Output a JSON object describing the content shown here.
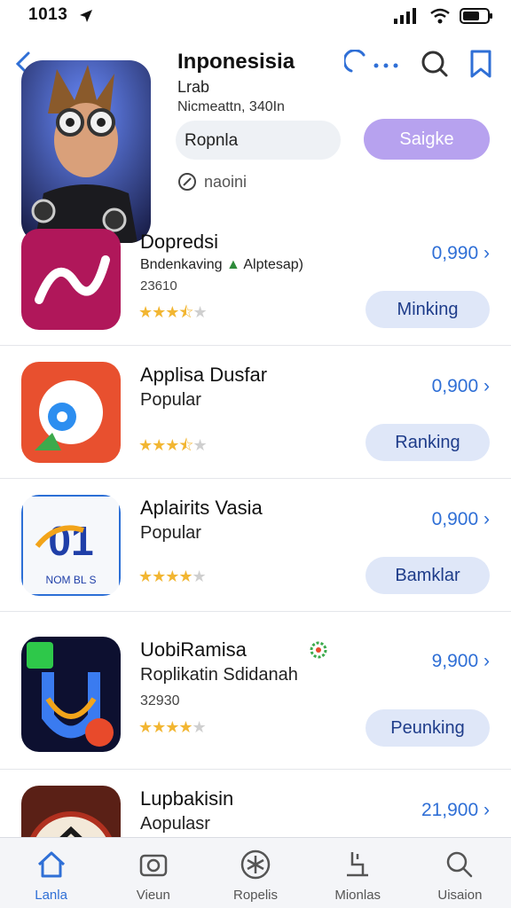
{
  "status_bar": {
    "time": "1013"
  },
  "hero": {
    "title": "Inponesisia",
    "subtitle": "Lrab",
    "line2": "Nicmeattn, 340In",
    "field_value": "Ropnla",
    "action_label": "Saigke",
    "meta_label": "naoini"
  },
  "apps": [
    {
      "title": "Dopredsi",
      "subtitle": "Bndenkaving",
      "subtitle_extra": "Alptesap)",
      "extra": "23610",
      "price": "0,990",
      "button": "Minking",
      "rating": 3.5
    },
    {
      "title": "Applisa Dusfar",
      "subtitle": "Popular",
      "extra": "",
      "price": "0,900",
      "button": "Ranking",
      "rating": 3.5
    },
    {
      "title": "Aplairits Vasia",
      "subtitle": "Popular",
      "extra": "",
      "price": "0,900",
      "button": "Bamklar",
      "rating": 4
    },
    {
      "title": "UobiRamisa",
      "subtitle": "Roplikatin Sdidanah",
      "extra": "32930",
      "price": "9,900",
      "button": "Peunking",
      "rating": 4.5
    },
    {
      "title": "Lupbakisin",
      "subtitle": "Aopulasr",
      "extra": "",
      "price": "21,900",
      "button": "",
      "rating": 0
    }
  ],
  "tabs": [
    {
      "label": "Lanla",
      "icon": "home-icon"
    },
    {
      "label": "Vieun",
      "icon": "camera-icon"
    },
    {
      "label": "Ropelis",
      "icon": "asterisk-icon"
    },
    {
      "label": "Mionlas",
      "icon": "tools-icon"
    },
    {
      "label": "Uisaion",
      "icon": "search-icon"
    }
  ],
  "colors": {
    "accent": "#2f6fd6",
    "action": "#b7a2ef",
    "star": "#f2b632"
  }
}
